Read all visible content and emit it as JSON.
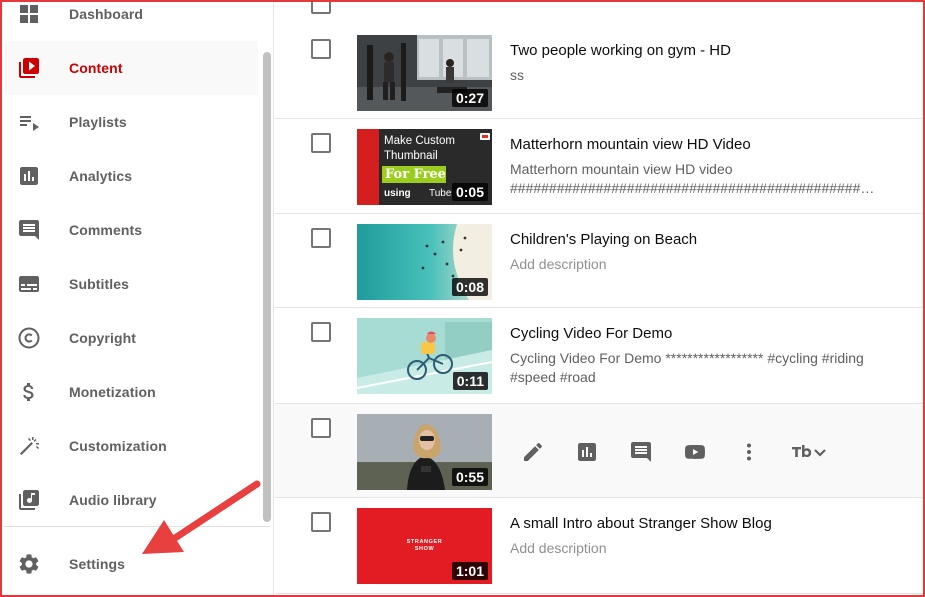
{
  "sidebar": {
    "items": [
      {
        "label": "Dashboard",
        "icon": "dashboard-icon"
      },
      {
        "label": "Content",
        "icon": "content-icon",
        "active": true
      },
      {
        "label": "Playlists",
        "icon": "playlists-icon"
      },
      {
        "label": "Analytics",
        "icon": "analytics-icon"
      },
      {
        "label": "Comments",
        "icon": "comments-icon"
      },
      {
        "label": "Subtitles",
        "icon": "subtitles-icon"
      },
      {
        "label": "Copyright",
        "icon": "copyright-icon"
      },
      {
        "label": "Monetization",
        "icon": "monetization-icon"
      },
      {
        "label": "Customization",
        "icon": "customization-icon"
      },
      {
        "label": "Audio library",
        "icon": "audio-library-icon"
      }
    ],
    "settings": {
      "label": "Settings",
      "icon": "gear-icon"
    }
  },
  "videos": [
    {
      "title": "Two people working on gym - HD",
      "description": "ss",
      "duration": "0:27"
    },
    {
      "title": "Matterhorn mountain view HD Video",
      "description_line1": "Matterhorn mountain view HD video",
      "description_line2": "##################################################",
      "duration": "0:05",
      "thumb_text_1": "Make Custom",
      "thumb_text_2": "Thumbnail",
      "thumb_text_3": "For Free",
      "thumb_text_4": "using",
      "thumb_text_5": "Tube"
    },
    {
      "title": "Children's Playing on Beach",
      "description": "Add description",
      "duration": "0:08"
    },
    {
      "title": "Cycling Video For Demo",
      "description": "Cycling Video For Demo ****************** #cycling #riding #speed #road",
      "duration": "0:11"
    },
    {
      "title": "",
      "duration": "0:55",
      "actions": [
        "edit-icon",
        "analytics-icon",
        "comments-icon",
        "youtube-icon",
        "more-vert-icon",
        "tubebuddy-icon"
      ]
    },
    {
      "title": "A small Intro about Stranger Show Blog",
      "description": "Add description",
      "duration": "1:01",
      "thumb_text_1": "STRANGER",
      "thumb_text_2": "SHOW"
    }
  ],
  "colors": {
    "accent": "#cc0000",
    "annotation_arrow": "#e8403f",
    "border": "#e6383b"
  }
}
